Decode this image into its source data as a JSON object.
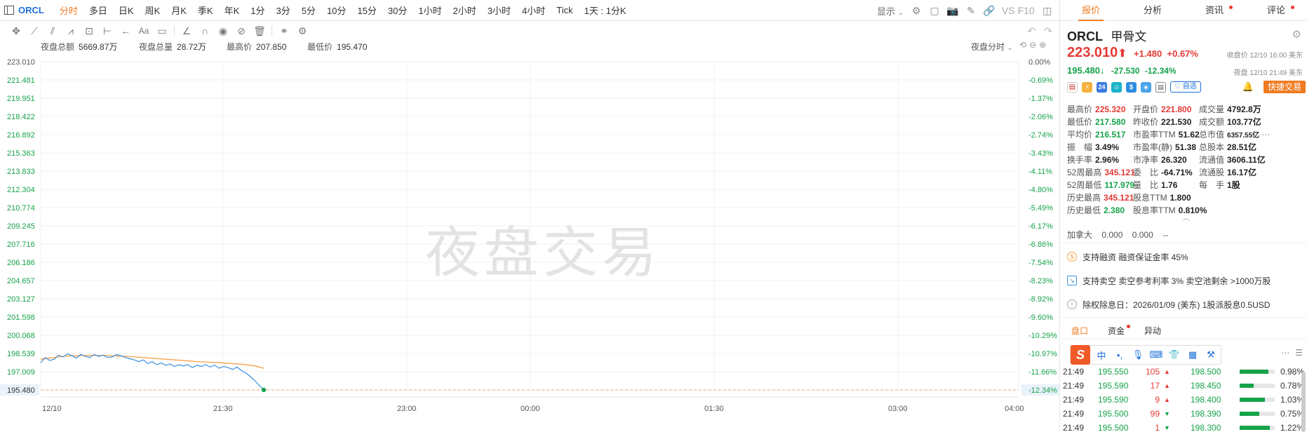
{
  "toolbar": {
    "symbol": "ORCL",
    "periods": [
      "分时",
      "多日",
      "日K",
      "周K",
      "月K",
      "季K",
      "年K",
      "1分",
      "3分",
      "5分",
      "10分",
      "15分",
      "30分",
      "1小时",
      "2小时",
      "3小时",
      "4小时",
      "Tick",
      "1天 : 1分K"
    ],
    "active_period": "分时",
    "display_label": "显示",
    "vs_label": "VS F10"
  },
  "stats": {
    "night_amount_label": "夜盘总额",
    "night_amount": "5669.87万",
    "night_volume_label": "夜盘总量",
    "night_volume": "28.72万",
    "high_label": "最高价",
    "high": "207.850",
    "low_label": "最低价",
    "low": "195.470",
    "mode_label": "夜盘分时"
  },
  "watermark": "夜盘交易",
  "chart_data": {
    "type": "line",
    "x_ticks": [
      "12/10",
      "21:30",
      "23:00",
      "00:00",
      "01:30",
      "03:00",
      "04:00"
    ],
    "y_ticks": [
      "223.010",
      "221.481",
      "219.951",
      "218.422",
      "216.892",
      "215.363",
      "213.833",
      "212.304",
      "210.774",
      "209.245",
      "207.716",
      "206.186",
      "204.657",
      "203.127",
      "201.598",
      "200.068",
      "198.539",
      "197.009",
      "195.480"
    ],
    "y_pct_ticks": [
      "0.00%",
      "-0.69%",
      "-1.37%",
      "-2.06%",
      "-2.74%",
      "-3.43%",
      "-4.11%",
      "-4.80%",
      "-5.49%",
      "-6.17%",
      "-6.86%",
      "-7.54%",
      "-8.23%",
      "-8.92%",
      "-9.60%",
      "-10.29%",
      "-10.97%",
      "-11.66%",
      "-12.34%"
    ],
    "ylim": [
      195.48,
      223.01
    ],
    "current_price_label": "195.480",
    "current_pct_label": "-12.34%",
    "price_series": [
      [
        0,
        197.75
      ],
      [
        2,
        198.2
      ],
      [
        4,
        197.95
      ],
      [
        6,
        198.05
      ],
      [
        8,
        198.4
      ],
      [
        10,
        198.25
      ],
      [
        12,
        198.5
      ],
      [
        14,
        198.35
      ],
      [
        16,
        198.15
      ],
      [
        18,
        198.45
      ],
      [
        20,
        198.3
      ],
      [
        22,
        198.2
      ],
      [
        24,
        198.45
      ],
      [
        26,
        198.3
      ],
      [
        28,
        198.4
      ],
      [
        30,
        198.2
      ],
      [
        32,
        198.25
      ],
      [
        34,
        198.45
      ],
      [
        36,
        198.35
      ],
      [
        38,
        198.2
      ],
      [
        40,
        198.1
      ],
      [
        42,
        198.0
      ],
      [
        44,
        197.85
      ],
      [
        46,
        198.0
      ],
      [
        48,
        197.7
      ],
      [
        50,
        197.85
      ],
      [
        52,
        197.6
      ],
      [
        54,
        197.75
      ],
      [
        56,
        197.55
      ],
      [
        58,
        197.65
      ],
      [
        60,
        197.45
      ],
      [
        62,
        197.6
      ],
      [
        64,
        197.5
      ],
      [
        66,
        197.6
      ],
      [
        68,
        197.35
      ],
      [
        70,
        197.55
      ],
      [
        72,
        197.45
      ],
      [
        74,
        197.6
      ],
      [
        76,
        197.4
      ],
      [
        78,
        197.55
      ],
      [
        80,
        197.3
      ],
      [
        82,
        197.45
      ],
      [
        84,
        197.35
      ],
      [
        86,
        197.2
      ],
      [
        88,
        197.4
      ],
      [
        90,
        197.1
      ],
      [
        92,
        196.9
      ],
      [
        94,
        196.6
      ],
      [
        96,
        196.25
      ],
      [
        98,
        195.85
      ],
      [
        100,
        195.48
      ]
    ],
    "avg_series": [
      [
        0,
        198.05
      ],
      [
        10,
        198.3
      ],
      [
        20,
        198.38
      ],
      [
        30,
        198.36
      ],
      [
        40,
        198.28
      ],
      [
        50,
        198.14
      ],
      [
        60,
        198.0
      ],
      [
        70,
        197.86
      ],
      [
        80,
        197.76
      ],
      [
        90,
        197.64
      ],
      [
        96,
        197.5
      ],
      [
        100,
        197.3
      ]
    ],
    "colors": {
      "price": "#3b8fe0",
      "avg": "#f5a24b",
      "up": "#e53935",
      "down": "#16a34a",
      "grid": "#f0f0f0",
      "ref": "#f3a07a"
    }
  },
  "panel": {
    "tabs": [
      "报价",
      "分析",
      "资讯",
      "评论"
    ],
    "active_tab": "报价",
    "code": "ORCL",
    "name": "甲骨文",
    "price": "223.010",
    "price_arrow": "⬆",
    "change": "+1.480",
    "change_pct": "+0.67%",
    "close_info": "收盘价 12/10 16:00 美东",
    "night_price": "195.480",
    "night_arrow": "↓",
    "night_change": "-27.530",
    "night_change_pct": "-12.34%",
    "night_info": "夜盘 12/10 21:49 美东",
    "watch_label": "♡ 自选",
    "fast_trade_label": "快捷交易",
    "metrics": [
      [
        {
          "l": "最高价",
          "v": "225.320",
          "c": "up"
        },
        {
          "l": "开盘价",
          "v": "221.800",
          "c": "up"
        },
        {
          "l": "成交量",
          "v": "4792.8万",
          "c": ""
        }
      ],
      [
        {
          "l": "最低价",
          "v": "217.580",
          "c": "down"
        },
        {
          "l": "昨收价",
          "v": "221.530",
          "c": ""
        },
        {
          "l": "成交额",
          "v": "103.77亿",
          "c": ""
        }
      ],
      [
        {
          "l": "平均价",
          "v": "216.517",
          "c": "down"
        },
        {
          "l": "市盈率TTM",
          "v": "51.62",
          "c": ""
        },
        {
          "l": "总市值",
          "v": "6357.55亿",
          "c": "small"
        }
      ],
      [
        {
          "l": "振　幅",
          "v": "3.49%",
          "c": ""
        },
        {
          "l": "市盈率(静)",
          "v": "51.38",
          "c": ""
        },
        {
          "l": "总股本",
          "v": "28.51亿",
          "c": ""
        }
      ],
      [
        {
          "l": "换手率",
          "v": "2.96%",
          "c": ""
        },
        {
          "l": "市净率",
          "v": "26.320",
          "c": ""
        },
        {
          "l": "流通值",
          "v": "3606.11亿",
          "c": ""
        }
      ],
      [
        {
          "l": "52周最高",
          "v": "345.121",
          "c": "up"
        },
        {
          "l": "委　比",
          "v": "-64.71%",
          "c": ""
        },
        {
          "l": "流通股",
          "v": "16.17亿",
          "c": ""
        }
      ],
      [
        {
          "l": "52周最低",
          "v": "117.979",
          "c": "down"
        },
        {
          "l": "量　比",
          "v": "1.76",
          "c": ""
        },
        {
          "l": "每　手",
          "v": "1股",
          "c": ""
        }
      ],
      [
        {
          "l": "历史最高",
          "v": "345.121",
          "c": "up"
        },
        {
          "l": "股息TTM",
          "v": "1.800",
          "c": ""
        },
        {
          "l": "",
          "v": "",
          "c": ""
        }
      ],
      [
        {
          "l": "历史最低",
          "v": "2.380",
          "c": "down"
        },
        {
          "l": "股息率TTM",
          "v": "0.810%",
          "c": ""
        },
        {
          "l": "",
          "v": "",
          "c": ""
        }
      ]
    ],
    "canada": {
      "label": "加拿大",
      "v1": "0.000",
      "v2": "0.000",
      "v3": "--"
    },
    "notices": [
      "支持融资  融资保证金率 45%",
      "支持卖空  卖空参考利率 3%  卖空池剩余 >1000万股",
      "除权除息日：2026/01/09 (美东)  1股派股息0.5USD"
    ],
    "subtabs": [
      "盘口",
      "资金",
      "异动"
    ],
    "active_subtab": "盘口",
    "ticks": [
      {
        "time": "21:49",
        "p1": "195.550",
        "vol": "105",
        "dir": "up",
        "p2": "198.500",
        "fill": 0.82,
        "pct": "0.98%"
      },
      {
        "time": "21:49",
        "p1": "195.590",
        "vol": "17",
        "dir": "up",
        "p2": "198.450",
        "fill": 0.4,
        "pct": "0.78%"
      },
      {
        "time": "21:49",
        "p1": "195.590",
        "vol": "9",
        "dir": "up",
        "p2": "198.400",
        "fill": 0.72,
        "pct": "1.03%"
      },
      {
        "time": "21:49",
        "p1": "195.500",
        "vol": "99",
        "dir": "down",
        "p2": "198.390",
        "fill": 0.55,
        "pct": "0.75%"
      },
      {
        "time": "21:49",
        "p1": "195.500",
        "vol": "1",
        "dir": "down",
        "p2": "198.300",
        "fill": 0.85,
        "pct": "1.22%"
      }
    ]
  }
}
